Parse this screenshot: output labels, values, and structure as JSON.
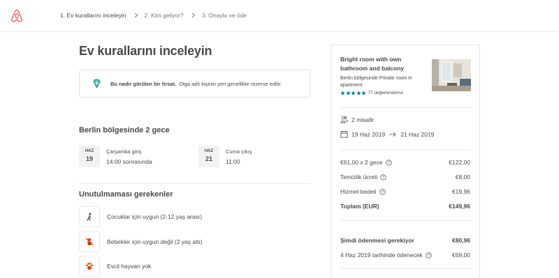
{
  "header": {
    "steps": [
      {
        "label": "1. Ev kurallarını inceleyin",
        "active": true
      },
      {
        "label": "2. Kim geliyor?",
        "active": false
      },
      {
        "label": "3. Onayla ve öde",
        "active": false
      }
    ]
  },
  "main": {
    "title": "Ev kurallarını inceleyin",
    "rare": {
      "bold": "Bu nadir görülen bir fırsat.",
      "text": "Olga adlı kişinin yeri genellikle rezerve edilir."
    },
    "stay_title": "Berlin bölgesinde 2 gece",
    "checkin": {
      "month": "HAZ",
      "day": "19",
      "label": "Çarşamba giriş",
      "time": "14:00 sonrasında"
    },
    "checkout": {
      "month": "HAZ",
      "day": "21",
      "label": "Cuma çıkış",
      "time": "11:00"
    },
    "rules_title": "Unutulmaması gerekenler",
    "rules": [
      {
        "icon": "child-icon",
        "text": "Çocuklar için uygun (2-12 yaş arası)"
      },
      {
        "icon": "no-infants-icon",
        "text": "Bebekler için uygun değil (2 yaş altı)"
      },
      {
        "icon": "paw-icon",
        "text": "Evcil hayvan yok"
      }
    ]
  },
  "card": {
    "title": "Bright room with own bathroom and balcony",
    "subtitle": "Berlin bölgesinde Private room in apartment",
    "rating_stars": 5,
    "reviews": "77 değerlendirme",
    "guests": "2 misafir",
    "date_from": "19 Haz 2019",
    "date_to": "21 Haz 2019",
    "prices": [
      {
        "label": "€61,00 x 2 gece",
        "value": "€122,00",
        "help": true
      },
      {
        "label": "Temizlik ücreti",
        "value": "€8,00",
        "help": true
      },
      {
        "label": "Hizmet bedeli",
        "value": "€19,96",
        "help": true
      },
      {
        "label": "Toplam (EUR)",
        "value": "€149,96",
        "help": false
      }
    ],
    "due_now": {
      "label": "Şimdi ödenmesi gerekiyor",
      "value": "€80,96"
    },
    "due_later": {
      "label": "4 Haz 2019 tarihinde ödenecek",
      "value": "€69,00"
    }
  },
  "colors": {
    "brand": "#FF5A5F",
    "teal": "#008489",
    "text": "#484848",
    "muted": "#767676"
  }
}
